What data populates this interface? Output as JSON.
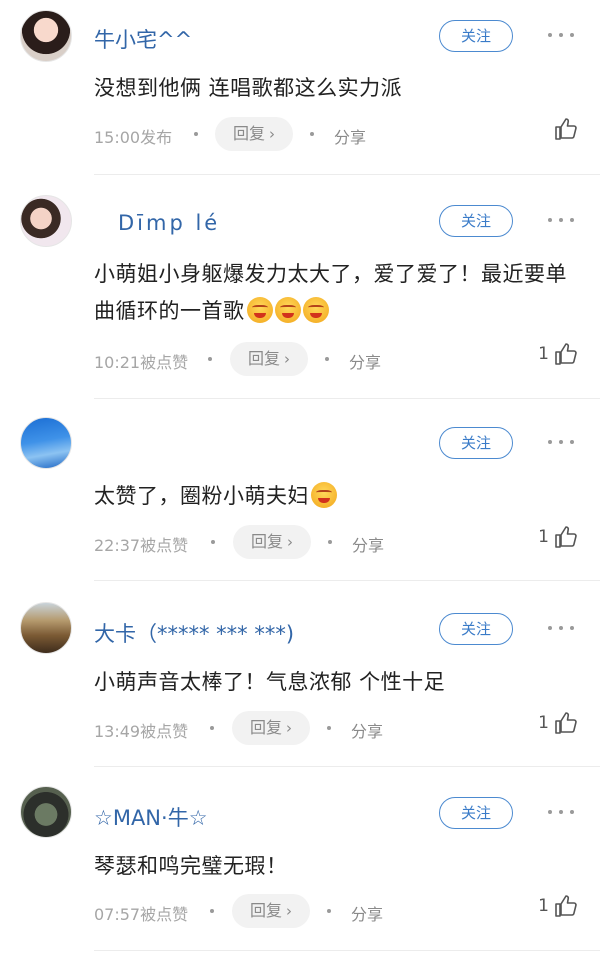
{
  "comments": [
    {
      "username": "牛小宅^^",
      "follow_label": "关注",
      "text": "没想到他俩 连唱歌都这么实力派",
      "emoji_count": 0,
      "time": "15:00发布",
      "reply_label": "回复",
      "share_label": "分享",
      "likes": ""
    },
    {
      "username": "Dīmp lé",
      "follow_label": "关注",
      "text": "小萌姐小身躯爆发力太大了，爱了爱了！最近要单曲循环的一首歌",
      "emoji_count": 3,
      "time": "10:21被点赞",
      "reply_label": "回复",
      "share_label": "分享",
      "likes": "1"
    },
    {
      "username": "",
      "follow_label": "关注",
      "text": "太赞了，圈粉小萌夫妇",
      "emoji_count": 1,
      "time": "22:37被点赞",
      "reply_label": "回复",
      "share_label": "分享",
      "likes": "1"
    },
    {
      "username": "大卡（***** *** ***)",
      "follow_label": "关注",
      "text": "小萌声音太棒了！气息浓郁 个性十足",
      "emoji_count": 0,
      "time": "13:49被点赞",
      "reply_label": "回复",
      "share_label": "分享",
      "likes": "1"
    },
    {
      "username": "☆MAN·牛☆",
      "follow_label": "关注",
      "text": "琴瑟和鸣完璧无瑕！",
      "emoji_count": 0,
      "time": "07:57被点赞",
      "reply_label": "回复",
      "share_label": "分享",
      "likes": "1"
    }
  ],
  "colors": {
    "username": "#3266a8",
    "follow_border": "#4c8ad0",
    "meta": "#a6a6a6"
  },
  "icons": {
    "more": "more-dots-icon",
    "like": "thumbs-up-icon",
    "reply_arrow": "chevron-right-icon"
  }
}
